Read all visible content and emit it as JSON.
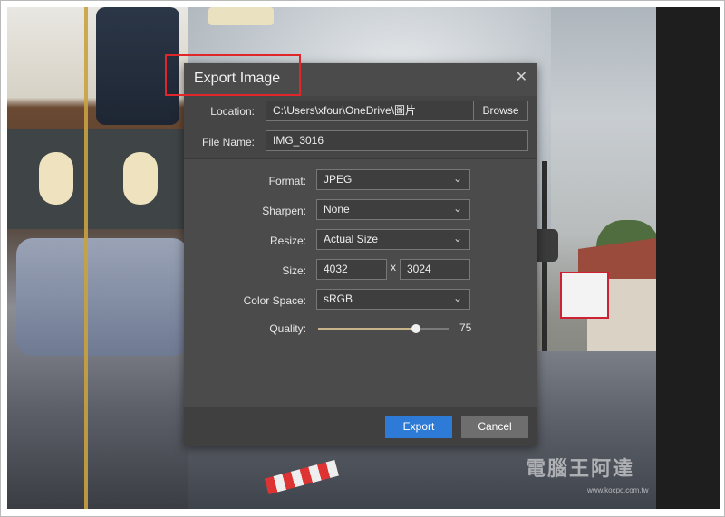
{
  "dialog": {
    "title": "Export Image",
    "close_glyph": "✕",
    "location": {
      "label": "Location:",
      "value": "C:\\Users\\xfour\\OneDrive\\圖片",
      "browse_label": "Browse"
    },
    "file_name": {
      "label": "File Name:",
      "value": "IMG_3016"
    },
    "format": {
      "label": "Format:",
      "value": "JPEG"
    },
    "sharpen": {
      "label": "Sharpen:",
      "value": "None"
    },
    "resize": {
      "label": "Resize:",
      "value": "Actual Size"
    },
    "size": {
      "label": "Size:",
      "width": "4032",
      "separator": "x",
      "height": "3024"
    },
    "color_space": {
      "label": "Color Space:",
      "value": "sRGB"
    },
    "quality": {
      "label": "Quality:",
      "value": "75",
      "level": 0.75
    },
    "export_label": "Export",
    "cancel_label": "Cancel"
  },
  "watermark": {
    "text": "電腦王阿達",
    "url": "www.kocpc.com.tw"
  },
  "colors": {
    "accent": "#2d7bd7",
    "highlight": "#e0262b",
    "dialog_bg": "#4b4b4b"
  },
  "icons": {
    "close": "close-icon",
    "chevron": "chevron-down-icon"
  }
}
